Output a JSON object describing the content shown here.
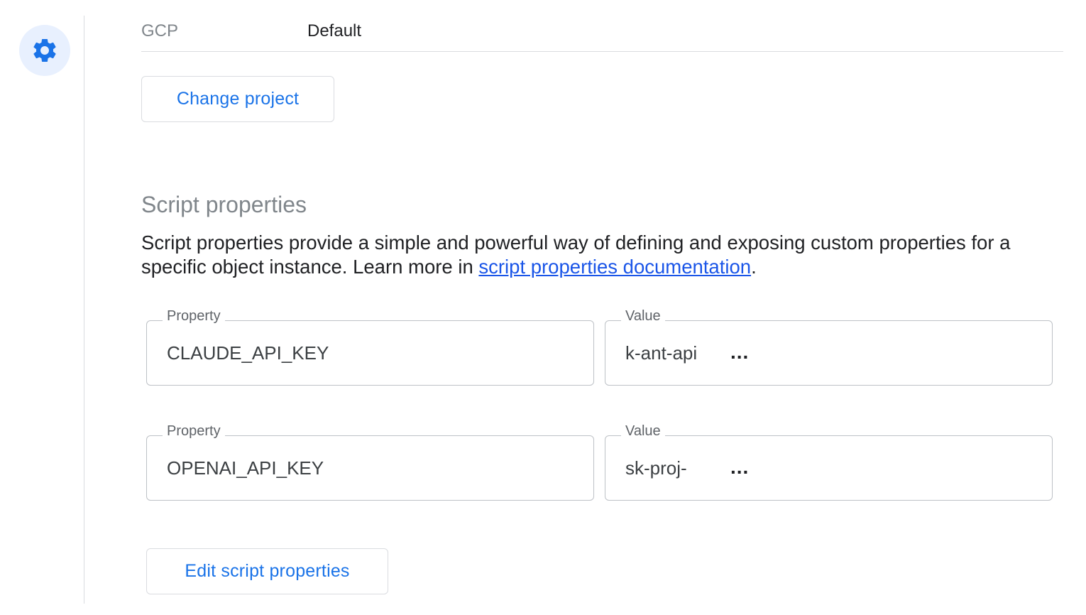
{
  "rail": {
    "settings_icon": "gear-icon"
  },
  "project": {
    "label": "GCP",
    "value": "Default",
    "change_button": "Change project"
  },
  "script_properties": {
    "title": "Script properties",
    "description_prefix": "Script properties provide a simple and powerful way of defining and exposing custom properties for a specific object instance. Learn more in ",
    "doc_link": "script properties documentation",
    "description_suffix": ".",
    "rows": [
      {
        "property_label": "Property",
        "property_value": "CLAUDE_API_KEY",
        "value_label": "Value",
        "value": "k-ant-api",
        "masked": "..."
      },
      {
        "property_label": "Property",
        "property_value": "OPENAI_API_KEY",
        "value_label": "Value",
        "value": "sk-proj-",
        "masked": "..."
      }
    ],
    "edit_button": "Edit script properties"
  },
  "colors": {
    "accent": "#1a73e8",
    "fab_bg": "#e8f0fe",
    "border": "#dadce0"
  }
}
